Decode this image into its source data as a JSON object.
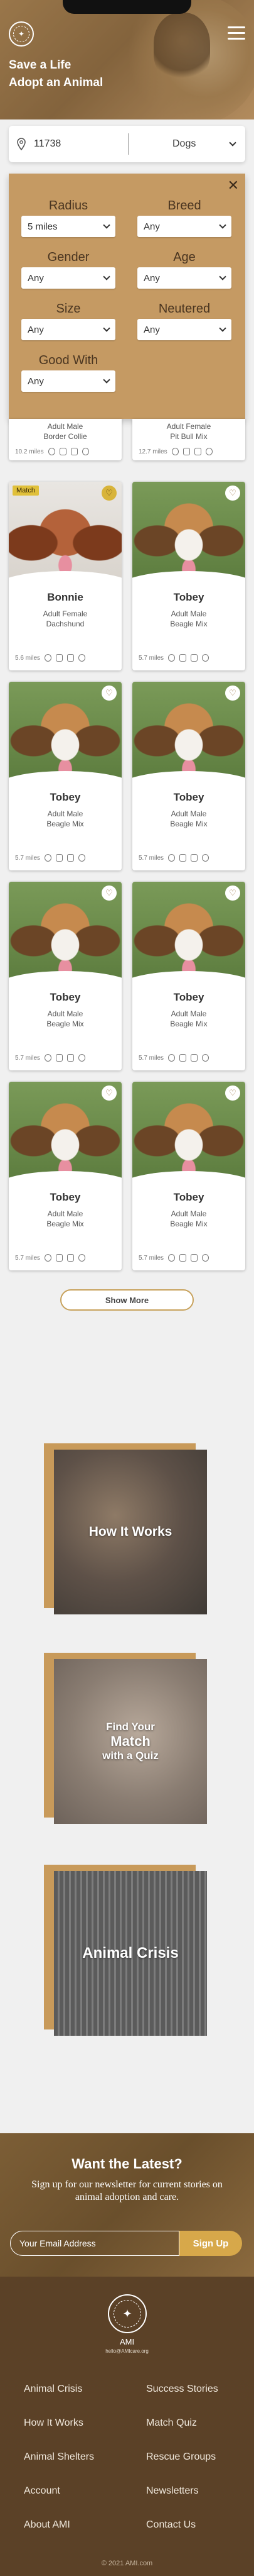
{
  "header": {
    "title_line1": "Save a Life",
    "title_line2": "Adopt an Animal"
  },
  "search": {
    "zip": "11738",
    "species": "Dogs"
  },
  "filters": [
    {
      "label": "Radius",
      "value": "5 miles"
    },
    {
      "label": "Breed",
      "value": "Any"
    },
    {
      "label": "Gender",
      "value": "Any"
    },
    {
      "label": "Age",
      "value": "Any"
    },
    {
      "label": "Size",
      "value": "Any"
    },
    {
      "label": "Neutered",
      "value": "Any"
    },
    {
      "label": "Good With",
      "value": "Any"
    }
  ],
  "partial_cards": [
    {
      "desc1": "Adult Male",
      "desc2": "Border Collie",
      "dist": "10.2 miles"
    },
    {
      "desc1": "Adult Female",
      "desc2": "Pit Bull Mix",
      "dist": "12.7 miles"
    }
  ],
  "pets": [
    {
      "name": "Bonnie",
      "desc1": "Adult Female",
      "desc2": "Dachshund",
      "dist": "5.6 miles",
      "badge": "Match"
    },
    {
      "name": "Tobey",
      "desc1": "Adult Male",
      "desc2": "Beagle Mix",
      "dist": "5.7 miles"
    },
    {
      "name": "Tobey",
      "desc1": "Adult Male",
      "desc2": "Beagle Mix",
      "dist": "5.7 miles"
    },
    {
      "name": "Tobey",
      "desc1": "Adult Male",
      "desc2": "Beagle Mix",
      "dist": "5.7 miles"
    },
    {
      "name": "Tobey",
      "desc1": "Adult Male",
      "desc2": "Beagle Mix",
      "dist": "5.7 miles"
    },
    {
      "name": "Tobey",
      "desc1": "Adult Male",
      "desc2": "Beagle Mix",
      "dist": "5.7 miles"
    },
    {
      "name": "Tobey",
      "desc1": "Adult Male",
      "desc2": "Beagle Mix",
      "dist": "5.7 miles"
    },
    {
      "name": "Tobey",
      "desc1": "Adult Male",
      "desc2": "Beagle Mix",
      "dist": "5.7 miles"
    }
  ],
  "show_more": "Show More",
  "features": [
    {
      "line1": "How It Works",
      "line2": "",
      "line3": ""
    },
    {
      "line1": "Find Your",
      "line2": "Match",
      "line3": "with a Quiz"
    },
    {
      "line1": "Animal Crisis",
      "line2": "",
      "line3": ""
    }
  ],
  "newsletter": {
    "title": "Want the Latest?",
    "subtitle": "Sign up for our newsletter for current stories on animal adoption and care.",
    "placeholder": "Your Email Address",
    "button": "Sign Up"
  },
  "footer": {
    "brand": "AMI",
    "email": "hello@AMIcare.org",
    "links": [
      "Animal Crisis",
      "Success Stories",
      "How It Works",
      "Match Quiz",
      "Animal Shelters",
      "Rescue Groups",
      "Account",
      "Newsletters",
      "About AMI",
      "Contact Us"
    ],
    "copyright": "© 2021 AMI.com"
  },
  "colors": {
    "accent": "#c59a63",
    "footer": "#5b4127",
    "badge": "#e0c03a"
  }
}
